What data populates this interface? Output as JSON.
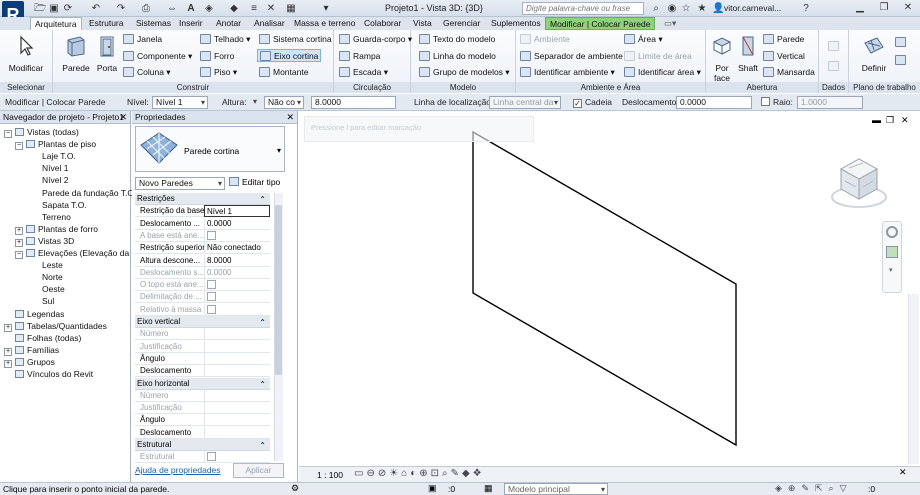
{
  "window": {
    "title": "Projeto1 - Vista 3D: {3D}",
    "search_placeholder": "Digite palavra-chave ou frase",
    "user": "vitor.carneval...",
    "logo": "R"
  },
  "tabs": [
    "Arquitetura",
    "Estrutura",
    "Sistemas",
    "Inserir",
    "Anotar",
    "Analisar",
    "Massa e terreno",
    "Colaborar",
    "Vista",
    "Gerenciar",
    "Suplementos",
    "Modificar | Colocar Parede"
  ],
  "ribbon": {
    "selecionar": {
      "label": "Selecionar",
      "modify": "Modificar"
    },
    "construir": {
      "label": "Construir",
      "parede": "Parede",
      "porta": "Porta",
      "janela": "Janela",
      "componente": "Componente",
      "coluna": "Coluna",
      "telhado": "Telhado",
      "forro": "Forro",
      "piso": "Piso",
      "sistema_cortina": "Sistema cortina",
      "eixo_cortina": "Eixo cortina",
      "montante": "Montante"
    },
    "circulacao": {
      "label": "Circulação",
      "guarda_corpo": "Guarda-corpo",
      "rampa": "Rampa",
      "escada": "Escada"
    },
    "modelo": {
      "label": "Modelo",
      "texto": "Texto do modelo",
      "linha": "Linha do modelo",
      "grupo": "Grupo de modelos"
    },
    "ambiente": {
      "label": "Ambiente e Área",
      "ambiente": "Ambiente",
      "separador": "Separador de ambiente",
      "identificar_amb": "Identificar ambiente",
      "area": "Área",
      "limite": "Limite de área",
      "identificar_area": "Identificar área"
    },
    "abertura": {
      "label": "Abertura",
      "por_face": "Por face",
      "shaft": "Shaft",
      "parede": "Parede",
      "vertical": "Vertical",
      "mansarda": "Mansarda"
    },
    "dados": {
      "label": "Dados"
    },
    "plano": {
      "label": "Plano de trabalho",
      "definir": "Definir"
    }
  },
  "options_bar": {
    "context": "Modificar | Colocar Parede",
    "nivel_label": "Nível:",
    "nivel_value": "Nível 1",
    "altura_label": "Altura:",
    "altura_value": "Não co",
    "altura_num": "8.0000",
    "linha_label": "Linha de localização:",
    "linha_value": "Linha central da",
    "cadeia_label": "Cadeia",
    "deslocamento_label": "Deslocamento:",
    "deslocamento_value": "0.0000",
    "raio_label": "Raio:",
    "raio_value": "1.0000"
  },
  "project_browser": {
    "title": "Navegador de projeto - Projeto1",
    "items": [
      {
        "label": "Vistas (todas)",
        "level": 0,
        "toggle": "−"
      },
      {
        "label": "Plantas de piso",
        "level": 1,
        "toggle": "−"
      },
      {
        "label": "Laje T.O.",
        "level": 2,
        "toggle": ""
      },
      {
        "label": "Nível 1",
        "level": 2,
        "toggle": ""
      },
      {
        "label": "Nível 2",
        "level": 2,
        "toggle": ""
      },
      {
        "label": "Parede da fundação T.O.",
        "level": 2,
        "toggle": ""
      },
      {
        "label": "Sapata T.O.",
        "level": 2,
        "toggle": ""
      },
      {
        "label": "Terreno",
        "level": 2,
        "toggle": ""
      },
      {
        "label": "Plantas de forro",
        "level": 1,
        "toggle": "+"
      },
      {
        "label": "Vistas 3D",
        "level": 1,
        "toggle": "+"
      },
      {
        "label": "Elevações (Elevação da con",
        "level": 1,
        "toggle": "−"
      },
      {
        "label": "Leste",
        "level": 2,
        "toggle": ""
      },
      {
        "label": "Norte",
        "level": 2,
        "toggle": ""
      },
      {
        "label": "Oeste",
        "level": 2,
        "toggle": ""
      },
      {
        "label": "Sul",
        "level": 2,
        "toggle": ""
      },
      {
        "label": "Legendas",
        "level": 0,
        "toggle": ""
      },
      {
        "label": "Tabelas/Quantidades",
        "level": 0,
        "toggle": "+"
      },
      {
        "label": "Folhas (todas)",
        "level": 0,
        "toggle": ""
      },
      {
        "label": "Famílias",
        "level": 0,
        "toggle": "+"
      },
      {
        "label": "Grupos",
        "level": 0,
        "toggle": "+"
      },
      {
        "label": "Vínculos do Revit",
        "level": 0,
        "toggle": ""
      }
    ]
  },
  "properties": {
    "title": "Propriedades",
    "type_name": "Parede cortina",
    "instance": "Novo Paredes",
    "edit_type": "Editar tipo",
    "help_link": "Ajuda de propriedades",
    "apply": "Aplicar",
    "sections": [
      {
        "title": "Restrições",
        "rows": [
          {
            "k": "Restrição da base",
            "v": "Nível 1",
            "dis": false
          },
          {
            "k": "Deslocamento ...",
            "v": "0.0000",
            "dis": false
          },
          {
            "k": "A base está ane...",
            "v": "",
            "cb": true,
            "dis": true
          },
          {
            "k": "Restrição superior",
            "v": "Não conectado",
            "dis": false
          },
          {
            "k": "Altura descone...",
            "v": "8.0000",
            "dis": false
          },
          {
            "k": "Deslocamento s...",
            "v": "0.0000",
            "dis": true
          },
          {
            "k": "O topo está ane...",
            "v": "",
            "cb": true,
            "dis": true
          },
          {
            "k": "Delimitação de ...",
            "v": "",
            "cb": true,
            "dis": true
          },
          {
            "k": "Relativo à massa",
            "v": "",
            "cb": true,
            "dis": true
          }
        ]
      },
      {
        "title": "Eixo vertical",
        "rows": [
          {
            "k": "Número",
            "v": "",
            "dis": true
          },
          {
            "k": "Justificação",
            "v": "",
            "dis": true
          },
          {
            "k": "Ângulo",
            "v": "",
            "dis": false
          },
          {
            "k": "Deslocamento",
            "v": "",
            "dis": false
          }
        ]
      },
      {
        "title": "Eixo horizontal",
        "rows": [
          {
            "k": "Número",
            "v": "",
            "dis": true
          },
          {
            "k": "Justificação",
            "v": "",
            "dis": true
          },
          {
            "k": "Ângulo",
            "v": "",
            "dis": false
          },
          {
            "k": "Deslocamento",
            "v": "",
            "dis": false
          }
        ]
      },
      {
        "title": "Estrutural",
        "rows": [
          {
            "k": "Estrutural",
            "v": "",
            "cb": true,
            "dis": true
          }
        ]
      }
    ]
  },
  "viewport": {
    "scale": "1 : 100",
    "viewcube_label": "",
    "faded_hint": "Pressione l para editar marcação"
  },
  "status": {
    "message": "Clique para inserir o ponto inicial da parede.",
    "coord": ":0",
    "model": "Modelo principal"
  }
}
